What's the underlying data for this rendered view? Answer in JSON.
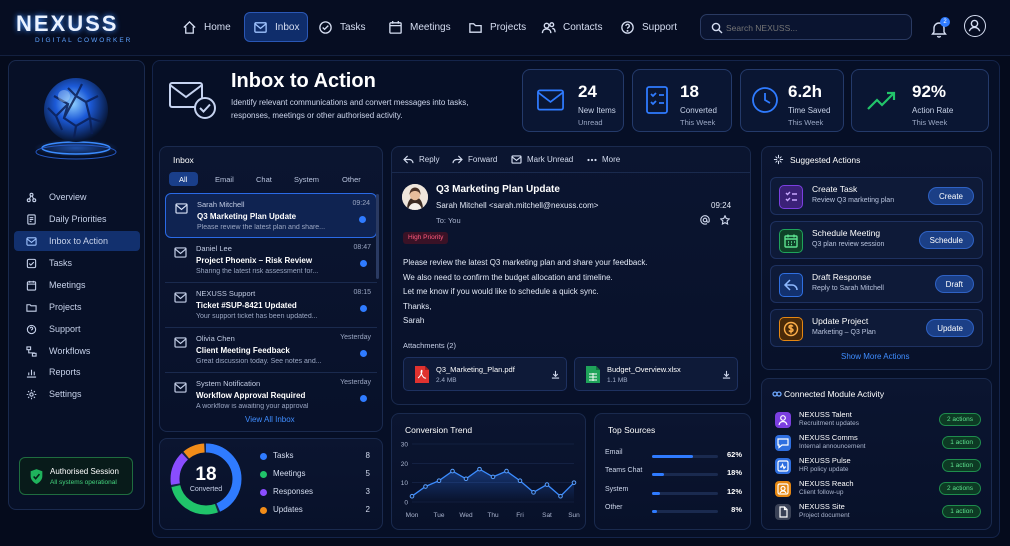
{
  "brand": {
    "name": "NEXUSS",
    "tagline": "DIGITAL COWORKER"
  },
  "nav": [
    {
      "label": "Home",
      "icon": "home-icon"
    },
    {
      "label": "Inbox",
      "icon": "inbox-icon"
    },
    {
      "label": "Tasks",
      "icon": "check-circle-icon"
    },
    {
      "label": "Meetings",
      "icon": "calendar-icon"
    },
    {
      "label": "Projects",
      "icon": "folder-icon"
    },
    {
      "label": "Contacts",
      "icon": "contacts-icon"
    },
    {
      "label": "Support",
      "icon": "support-icon"
    }
  ],
  "search": {
    "placeholder": "Search NEXUSS..."
  },
  "notifications": {
    "count": "2"
  },
  "sidebar": {
    "items": [
      {
        "label": "Overview"
      },
      {
        "label": "Daily Priorities"
      },
      {
        "label": "Inbox to Action"
      },
      {
        "label": "Tasks"
      },
      {
        "label": "Meetings"
      },
      {
        "label": "Projects"
      },
      {
        "label": "Support"
      },
      {
        "label": "Workflows"
      },
      {
        "label": "Reports"
      },
      {
        "label": "Settings"
      }
    ],
    "session": {
      "title": "Authorised Session",
      "status": "All systems operational"
    }
  },
  "header": {
    "title": "Inbox to Action",
    "description": "Identify relevant communications and convert messages into tasks, responses, meetings or other authorised activity."
  },
  "stats": [
    {
      "value": "24",
      "label": "New Items",
      "sub": "Unread"
    },
    {
      "value": "18",
      "label": "Converted",
      "sub": "This Week"
    },
    {
      "value": "6.2h",
      "label": "Time Saved",
      "sub": "This Week"
    },
    {
      "value": "92%",
      "label": "Action Rate",
      "sub": "This Week"
    }
  ],
  "inbox": {
    "title": "Inbox",
    "tabs": [
      "All",
      "Email",
      "Chat",
      "System",
      "Other"
    ],
    "messages": [
      {
        "from": "Sarah Mitchell",
        "subject": "Q3 Marketing Plan Update",
        "preview": "Please review the latest plan and share...",
        "time": "09:24"
      },
      {
        "from": "Daniel Lee",
        "subject": "Project Phoenix – Risk Review",
        "preview": "Sharing the latest risk assessment for...",
        "time": "08:47"
      },
      {
        "from": "NEXUSS Support",
        "subject": "Ticket #SUP-8421 Updated",
        "preview": "Your support ticket has been updated...",
        "time": "08:15"
      },
      {
        "from": "Olivia Chen",
        "subject": "Client Meeting Feedback",
        "preview": "Great discussion today. See notes and...",
        "time": "Yesterday"
      },
      {
        "from": "System Notification",
        "subject": "Workflow Approval Required",
        "preview": "A workflow is awaiting your approval",
        "time": "Yesterday"
      }
    ],
    "view_all": "View All Inbox"
  },
  "summary": {
    "total": "18",
    "label": "Converted",
    "items": [
      {
        "label": "Tasks",
        "value": 8,
        "color": "#2f7bff"
      },
      {
        "label": "Meetings",
        "value": 5,
        "color": "#20c46a"
      },
      {
        "label": "Responses",
        "value": 3,
        "color": "#8a4dff"
      },
      {
        "label": "Updates",
        "value": 2,
        "color": "#f28c18"
      }
    ]
  },
  "message": {
    "toolbar": [
      "Reply",
      "Forward",
      "Mark Unread",
      "More"
    ],
    "subject": "Q3 Marketing Plan Update",
    "sender": "Sarah Mitchell <sarah.mitchell@nexuss.com>",
    "to": "To: You",
    "time": "09:24",
    "priority": "High Priority",
    "body": [
      "Please review the latest Q3 marketing plan and share your feedback.",
      "We also need to confirm the budget allocation and timeline.",
      "Let me know if you would like to schedule a quick sync.",
      "Thanks,",
      "Sarah"
    ],
    "attachments_label": "Attachments (2)",
    "attachments": [
      {
        "name": "Q3_Marketing_Plan.pdf",
        "size": "2.4 MB"
      },
      {
        "name": "Budget_Overview.xlsx",
        "size": "1.1 MB"
      }
    ]
  },
  "chart_data": [
    {
      "type": "line",
      "title": "Conversion Trend",
      "categories": [
        "Mon",
        "Tue",
        "Wed",
        "Thu",
        "Fri",
        "Sat",
        "Sun"
      ],
      "x": [
        0,
        0.5,
        1,
        1.5,
        2,
        2.5,
        3,
        3.5,
        4,
        4.5,
        5,
        5.5,
        6
      ],
      "values": [
        3,
        8,
        11,
        16,
        12,
        17,
        13,
        16,
        11,
        5,
        9,
        3,
        10
      ],
      "yticks": [
        0,
        10,
        20,
        30
      ],
      "ylim": [
        0,
        30
      ]
    },
    {
      "type": "bar",
      "title": "Top Sources",
      "categories": [
        "Email",
        "Teams Chat",
        "System",
        "Other"
      ],
      "values": [
        62,
        18,
        12,
        8
      ],
      "labels": [
        "62%",
        "18%",
        "12%",
        "8%"
      ]
    }
  ],
  "suggested": {
    "title": "Suggested Actions",
    "items": [
      {
        "title": "Create Task",
        "sub": "Review Q3 marketing plan",
        "button": "Create",
        "color": "#7b3fe0"
      },
      {
        "title": "Schedule Meeting",
        "sub": "Q3 plan review session",
        "button": "Schedule",
        "color": "#1fa35a"
      },
      {
        "title": "Draft Response",
        "sub": "Reply to Sarah Mitchell",
        "button": "Draft",
        "color": "#2f6fe0"
      },
      {
        "title": "Update Project",
        "sub": "Marketing – Q3 Plan",
        "button": "Update",
        "color": "#e58712"
      }
    ],
    "more": "Show More Actions"
  },
  "modules": {
    "title": "Connected Module Activity",
    "items": [
      {
        "name": "NEXUSS Talent",
        "desc": "Recruitment updates",
        "pill": "2 actions",
        "color": "#7b3fe0"
      },
      {
        "name": "NEXUSS Comms",
        "desc": "Internal announcement",
        "pill": "1 action",
        "color": "#2f6fe0"
      },
      {
        "name": "NEXUSS Pulse",
        "desc": "HR policy update",
        "pill": "1 action",
        "color": "#2f6fe0"
      },
      {
        "name": "NEXUSS Reach",
        "desc": "Client follow-up",
        "pill": "2 actions",
        "color": "#e58712"
      },
      {
        "name": "NEXUSS Site",
        "desc": "Project document",
        "pill": "1 action",
        "color": "#3a4257"
      }
    ]
  }
}
